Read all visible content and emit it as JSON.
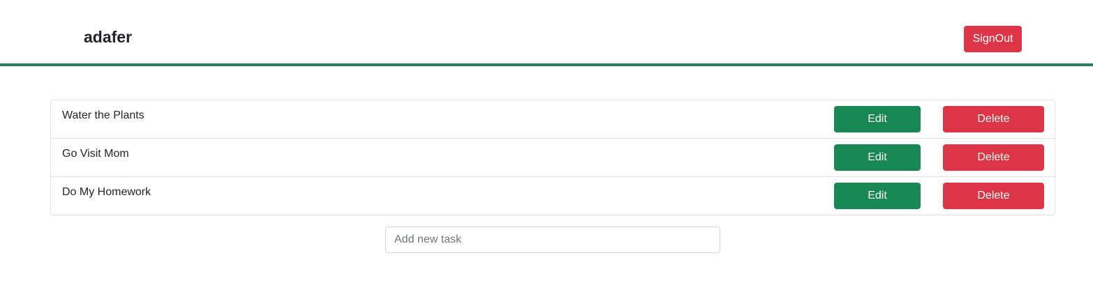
{
  "header": {
    "username": "adafer",
    "signout_label": "SignOut"
  },
  "tasks": [
    {
      "text": "Water the Plants",
      "edit_label": "Edit",
      "delete_label": "Delete"
    },
    {
      "text": "Go Visit Mom",
      "edit_label": "Edit",
      "delete_label": "Delete"
    },
    {
      "text": "Do My Homework",
      "edit_label": "Edit",
      "delete_label": "Delete"
    }
  ],
  "new_task": {
    "value": "",
    "placeholder": "Add new task"
  },
  "colors": {
    "header_border": "#2a7f55",
    "edit_button": "#198754",
    "delete_button": "#dc3545",
    "signout_button": "#dc3545"
  }
}
